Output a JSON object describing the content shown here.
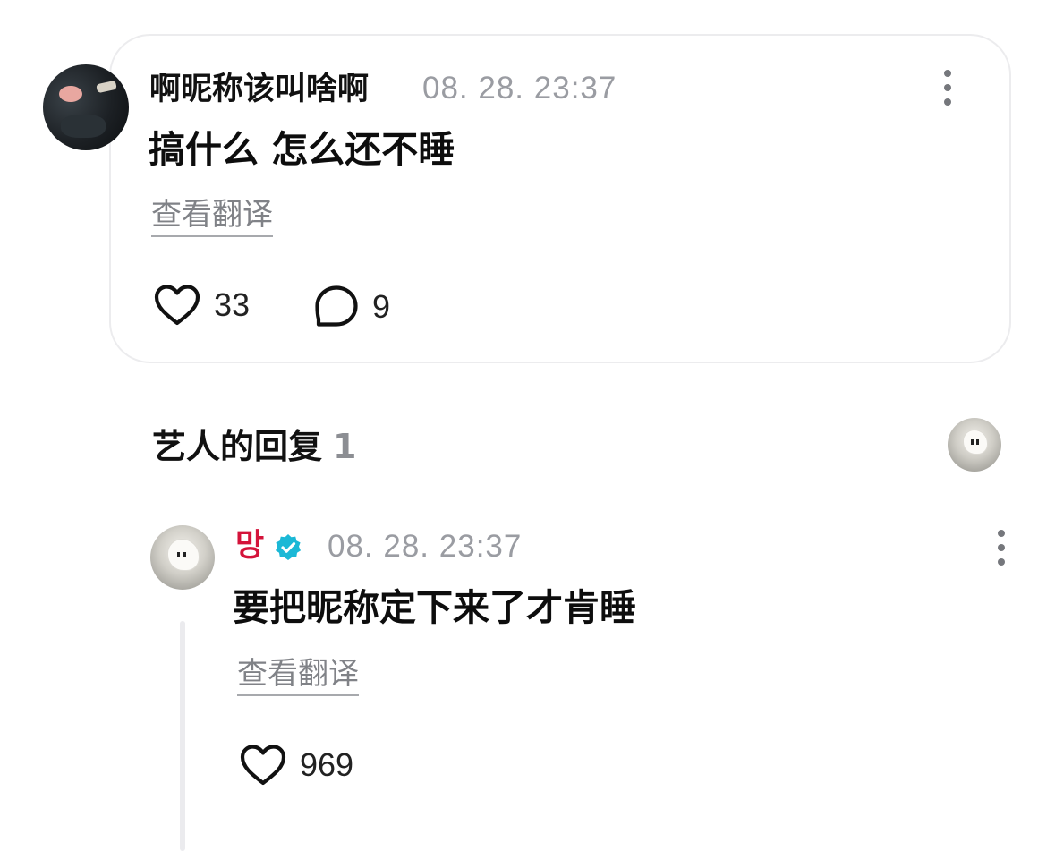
{
  "comment": {
    "nickname": "啊昵称该叫啥啊",
    "timestamp": "08. 28. 23:37",
    "text": "搞什么 怎么还不睡",
    "translate_label": "查看翻译",
    "likes": "33",
    "replies": "9",
    "like_icon": "heart-icon",
    "reply_icon": "speech-bubble-icon",
    "more_icon": "more-vertical-icon"
  },
  "artist_replies": {
    "title": "艺人的回复",
    "count": "1"
  },
  "reply": {
    "name": "망",
    "verified_icon": "verified-badge-icon",
    "timestamp": "08. 28. 23:37",
    "text": "要把昵称定下来了才肯睡",
    "translate_label": "查看翻译",
    "likes": "969",
    "like_icon": "heart-icon",
    "more_icon": "more-vertical-icon"
  },
  "colors": {
    "artist_name": "#d4133a",
    "verified_badge": "#1bb8d6",
    "timestamp": "#9a9ca2",
    "card_border": "#ececee",
    "thread_line": "#ebebee"
  }
}
